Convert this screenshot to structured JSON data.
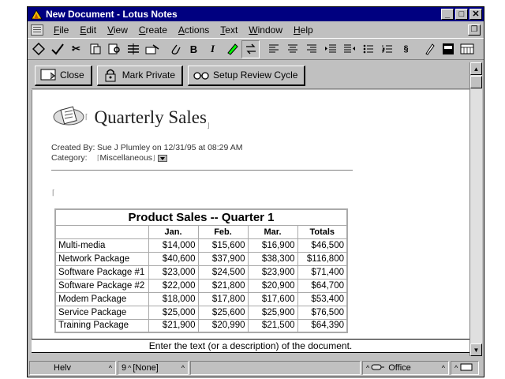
{
  "window": {
    "title": "New Document - Lotus Notes"
  },
  "menu": [
    "File",
    "Edit",
    "View",
    "Create",
    "Actions",
    "Text",
    "Window",
    "Help"
  ],
  "menu_mnemonics": [
    "F",
    "E",
    "V",
    "C",
    "A",
    "T",
    "W",
    "H"
  ],
  "toolbar": {
    "icons": [
      "navigator-icon",
      "check-icon",
      "cut-icon",
      "paste-icon",
      "find-icon",
      "field-icon",
      "link-icon",
      "attach-icon",
      "bold-icon",
      "italic-icon",
      "highlighter-icon",
      "refresh-icon",
      "align-left-icon",
      "align-center-icon",
      "align-right-icon",
      "indent-icon",
      "outdent-icon",
      "bullets-icon",
      "numbers-icon",
      "styles-icon",
      "pen-icon",
      "spell-check-icon",
      "calendar-icon"
    ],
    "bold_label": "B",
    "italic_label": "I"
  },
  "actions": {
    "close_label": "Close",
    "mark_private_label": "Mark Private",
    "review_label": "Setup Review Cycle"
  },
  "document": {
    "title": "Quarterly Sales",
    "created_by_label": "Created By:",
    "created_by_value": "Sue J Plumley on 12/31/95 at 08:29 AM",
    "category_label": "Category:",
    "category_value": "Miscellaneous"
  },
  "table": {
    "caption": "Product Sales -- Quarter 1",
    "headers": [
      "",
      "Jan.",
      "Feb.",
      "Mar.",
      "Totals"
    ],
    "rows": [
      [
        "Multi-media",
        "$14,000",
        "$15,600",
        "$16,900",
        "$46,500"
      ],
      [
        "Network Package",
        "$40,600",
        "$37,900",
        "$38,300",
        "$116,800"
      ],
      [
        "Software Package #1",
        "$23,000",
        "$24,500",
        "$23,900",
        "$71,400"
      ],
      [
        "Software Package #2",
        "$22,000",
        "$21,800",
        "$20,900",
        "$64,700"
      ],
      [
        "Modem Package",
        "$18,000",
        "$17,800",
        "$17,600",
        "$53,400"
      ],
      [
        "Service Package",
        "$25,000",
        "$25,600",
        "$25,900",
        "$76,500"
      ],
      [
        "Training Package",
        "$21,900",
        "$20,990",
        "$21,500",
        "$64,390"
      ]
    ]
  },
  "hint": "Enter the text (or a description) of the document.",
  "status": {
    "font": "Helv",
    "size": "9",
    "style": "[None]",
    "location": "Office"
  }
}
